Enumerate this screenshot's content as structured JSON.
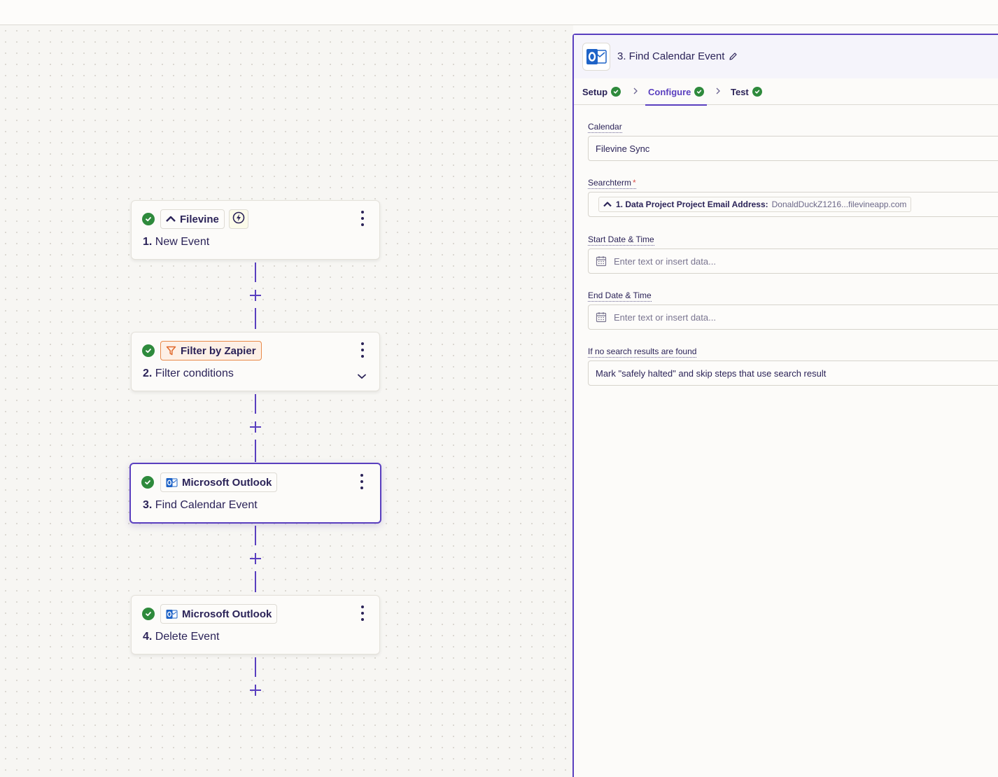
{
  "colors": {
    "accent": "#5a3fbf",
    "success": "#2e8a3c",
    "filter_orange": "#e98a4a",
    "outlook_blue": "#1e63c7"
  },
  "steps": [
    {
      "app": "Filevine",
      "app_icon": "filevine-logo-icon",
      "number": "1.",
      "title": "New Event",
      "has_trigger_badge": true
    },
    {
      "app": "Filter by Zapier",
      "app_icon": "filter-icon",
      "number": "2.",
      "title": "Filter conditions",
      "has_chevron": true
    },
    {
      "app": "Microsoft Outlook",
      "app_icon": "outlook-logo-icon",
      "number": "3.",
      "title": "Find Calendar Event",
      "selected": true
    },
    {
      "app": "Microsoft Outlook",
      "app_icon": "outlook-logo-icon",
      "number": "4.",
      "title": "Delete Event"
    }
  ],
  "panel": {
    "title": "3. Find Calendar Event",
    "tabs": [
      {
        "label": "Setup",
        "done": true
      },
      {
        "label": "Configure",
        "done": true,
        "active": true
      },
      {
        "label": "Test",
        "done": true
      }
    ],
    "fields": {
      "calendar": {
        "label": "Calendar",
        "value": "Filevine Sync"
      },
      "searchterm": {
        "label": "Searchterm",
        "required_mark": "*",
        "pill_label": "1. Data Project Project Email Address:",
        "pill_value": "DonaldDuckZ1216...filevineapp.com"
      },
      "start": {
        "label": "Start Date & Time",
        "placeholder": "Enter text or insert data..."
      },
      "end": {
        "label": "End Date & Time",
        "placeholder": "Enter text or insert data..."
      },
      "no_results": {
        "label": "If no search results are found",
        "value": "Mark \"safely halted\" and skip steps that use search result"
      }
    }
  }
}
